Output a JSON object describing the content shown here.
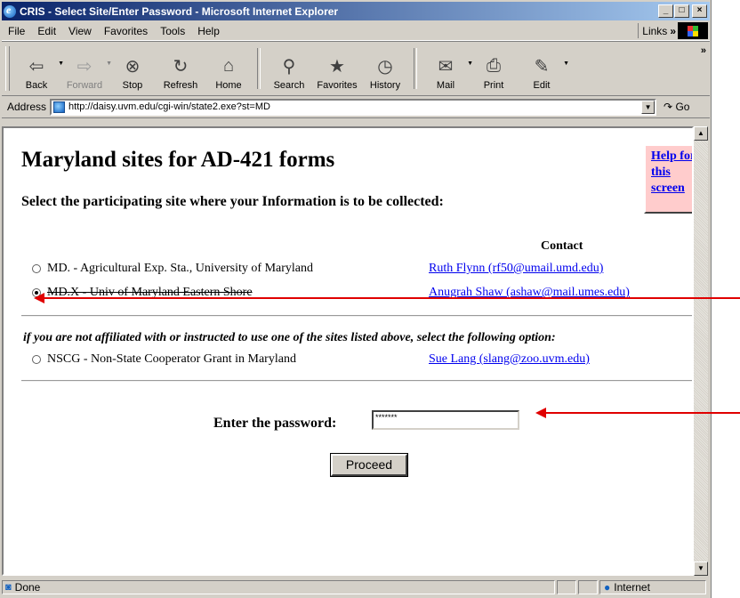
{
  "window": {
    "title": "CRIS - Select Site/Enter Password - Microsoft Internet Explorer",
    "controls": {
      "minimize": "_",
      "maximize": "□",
      "close": "×"
    }
  },
  "menubar": {
    "items": [
      {
        "label": "File"
      },
      {
        "label": "Edit"
      },
      {
        "label": "View"
      },
      {
        "label": "Favorites"
      },
      {
        "label": "Tools"
      },
      {
        "label": "Help"
      }
    ],
    "links_label": "Links"
  },
  "toolbar": {
    "buttons": [
      {
        "label": "Back",
        "icon": "⇦"
      },
      {
        "label": "Forward",
        "icon": "⇨"
      },
      {
        "label": "Stop",
        "icon": "⊗"
      },
      {
        "label": "Refresh",
        "icon": "↻"
      },
      {
        "label": "Home",
        "icon": "⌂"
      },
      {
        "label": "Search",
        "icon": "⚲"
      },
      {
        "label": "Favorites",
        "icon": "★"
      },
      {
        "label": "History",
        "icon": "◷"
      },
      {
        "label": "Mail",
        "icon": "✉"
      },
      {
        "label": "Print",
        "icon": "⎙"
      },
      {
        "label": "Edit",
        "icon": "✎"
      }
    ]
  },
  "address": {
    "label": "Address",
    "url": "http://daisy.uvm.edu/cgi-win/state2.exe?st=MD",
    "go_label": "Go"
  },
  "page": {
    "title": "Maryland sites for AD-421 forms",
    "instruction": "Select the participating site where your Information is to be collected:",
    "help_link": "Help for this screen",
    "contact_header": "Contact",
    "sites": [
      {
        "label": "MD. - Agricultural Exp. Sta., University of Maryland",
        "contact": "Ruth Flynn (rf50@umail.umd.edu)",
        "selected": false
      },
      {
        "label": "MD.X - Univ of Maryland Eastern Shore",
        "contact": "Anugrah Shaw (ashaw@mail.umes.edu)",
        "selected": true
      }
    ],
    "other_note": "if you are not affiliated with or instructed to use one of the sites listed above, select the following option:",
    "other_site": {
      "label": "NSCG - Non-State Cooperator Grant in Maryland",
      "contact": "Sue Lang (slang@zoo.uvm.edu)",
      "selected": false
    },
    "password_label": "Enter the password:",
    "password_value": "*******",
    "proceed_label": "Proceed"
  },
  "statusbar": {
    "status": "Done",
    "zone": "Internet"
  },
  "colors": {
    "annotation_arrow": "#e00000",
    "help_box_bg": "#ffcccc",
    "link": "#0000ee"
  }
}
